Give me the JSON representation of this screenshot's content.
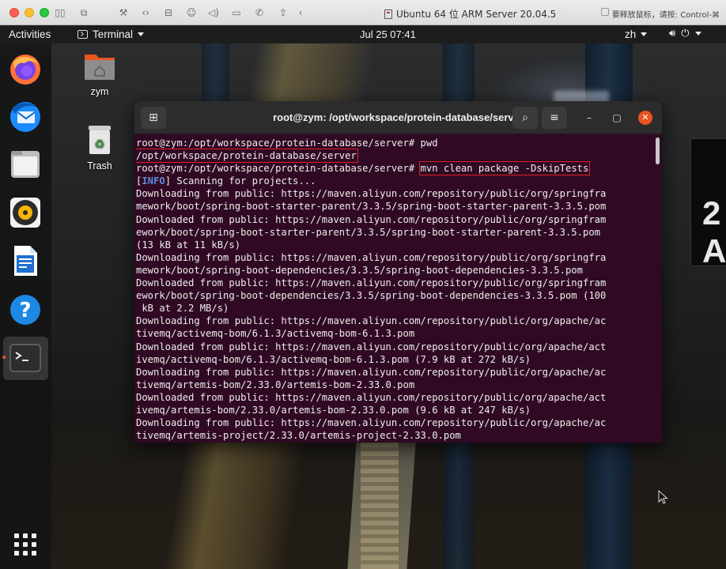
{
  "host": {
    "window_title": "Ubuntu 64 位 ARM Server 20.04.5",
    "hint": "要释放鼠标，请按: Control-⌘",
    "toolbar_icons": [
      "sidebar-toggle-icon",
      "snapshot-icon",
      "settings-wrench-icon",
      "code-brackets-icon",
      "hard-disk-icon",
      "user-account-icon",
      "sound-icon",
      "camera-icon",
      "phone-icon",
      "share-icon",
      "back-chevron-icon"
    ]
  },
  "panel": {
    "activities": "Activities",
    "app_name": "Terminal",
    "clock": "Jul 25  07:41",
    "lang": "zh"
  },
  "desktop": {
    "home_label": "zym",
    "trash_label": "Trash"
  },
  "dock": {
    "items": [
      "firefox-icon",
      "thunderbird-icon",
      "files-icon",
      "rhythmbox-icon",
      "writer-icon",
      "help-icon",
      "terminal-icon"
    ]
  },
  "terminal": {
    "title": "root@zym: /opt/workspace/protein-database/server",
    "lines": [
      {
        "a": "root@zym:/opt/workspace/protein-database/server# pwd"
      },
      {
        "a": "/opt/workspace/protein-database/server",
        "hl": true
      },
      {
        "a": "root@zym:/opt/workspace/protein-database/server# ",
        "cmd": "mvn clean package -DskipTests"
      },
      {
        "pre": "[",
        "tag": "INFO",
        "post": "] Scanning for projects..."
      },
      {
        "a": "Downloading from public: https://maven.aliyun.com/repository/public/org/springfra"
      },
      {
        "a": "mework/boot/spring-boot-starter-parent/3.3.5/spring-boot-starter-parent-3.3.5.pom"
      },
      {
        "a": "Downloaded from public: https://maven.aliyun.com/repository/public/org/springfram"
      },
      {
        "a": "ework/boot/spring-boot-starter-parent/3.3.5/spring-boot-starter-parent-3.3.5.pom"
      },
      {
        "a": "(13 kB at 11 kB/s)"
      },
      {
        "a": "Downloading from public: https://maven.aliyun.com/repository/public/org/springfra"
      },
      {
        "a": "mework/boot/spring-boot-dependencies/3.3.5/spring-boot-dependencies-3.3.5.pom"
      },
      {
        "a": "Downloaded from public: https://maven.aliyun.com/repository/public/org/springfram"
      },
      {
        "a": "ework/boot/spring-boot-dependencies/3.3.5/spring-boot-dependencies-3.3.5.pom (100"
      },
      {
        "a": " kB at 2.2 MB/s)"
      },
      {
        "a": "Downloading from public: https://maven.aliyun.com/repository/public/org/apache/ac"
      },
      {
        "a": "tivemq/activemq-bom/6.1.3/activemq-bom-6.1.3.pom"
      },
      {
        "a": "Downloaded from public: https://maven.aliyun.com/repository/public/org/apache/act"
      },
      {
        "a": "ivemq/activemq-bom/6.1.3/activemq-bom-6.1.3.pom (7.9 kB at 272 kB/s)"
      },
      {
        "a": "Downloading from public: https://maven.aliyun.com/repository/public/org/apache/ac"
      },
      {
        "a": "tivemq/artemis-bom/2.33.0/artemis-bom-2.33.0.pom"
      },
      {
        "a": "Downloaded from public: https://maven.aliyun.com/repository/public/org/apache/act"
      },
      {
        "a": "ivemq/artemis-bom/2.33.0/artemis-bom-2.33.0.pom (9.6 kB at 247 kB/s)"
      },
      {
        "a": "Downloading from public: https://maven.aliyun.com/repository/public/org/apache/ac"
      },
      {
        "a": "tivemq/artemis-project/2.33.0/artemis-project-2.33.0.pom"
      }
    ]
  },
  "colors": {
    "terminal_bg": "#300a24",
    "info": "#5f87d7",
    "highlight_box": "#e02020",
    "ubuntu_orange": "#e95420"
  }
}
